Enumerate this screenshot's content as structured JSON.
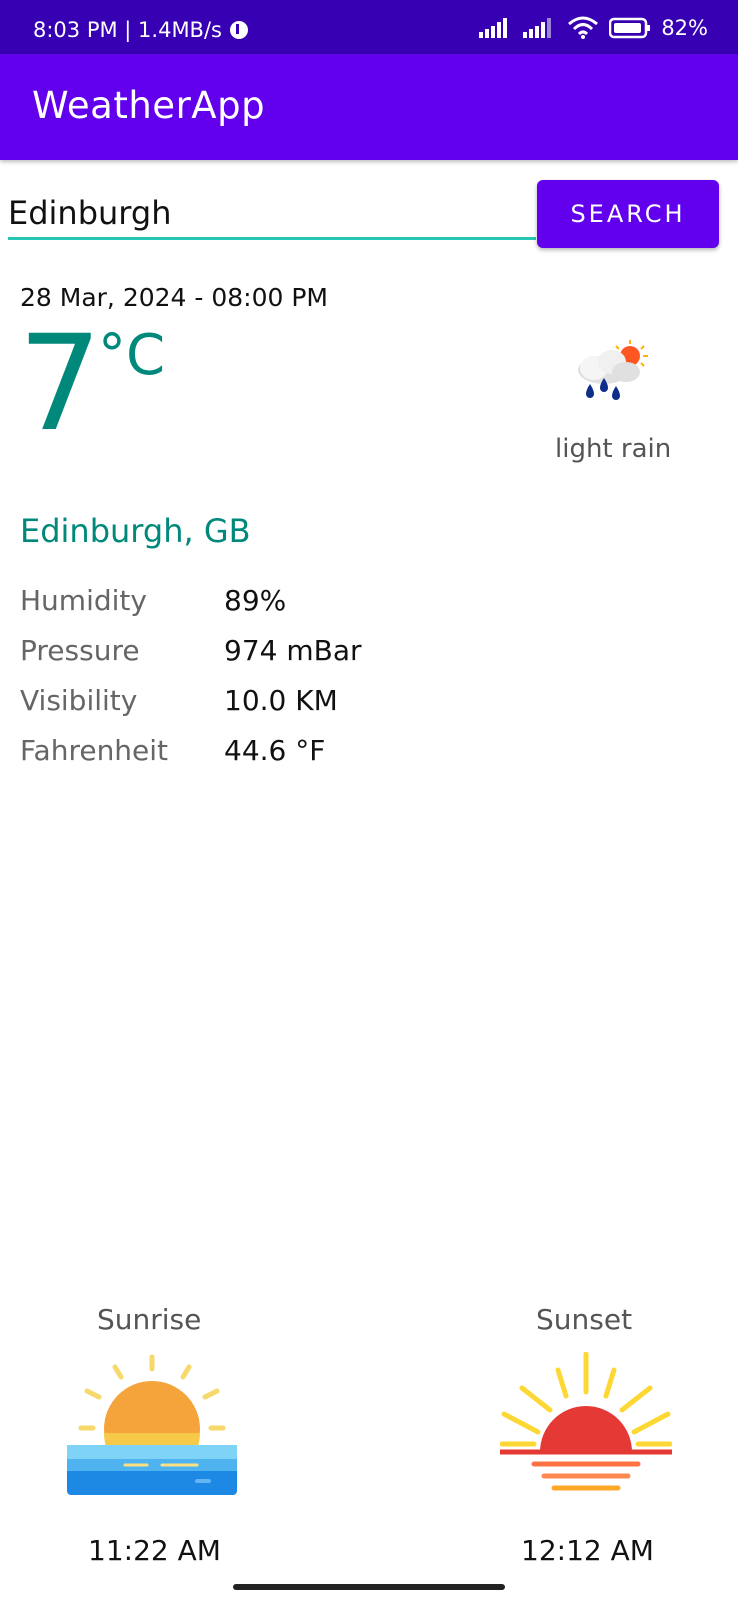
{
  "status_bar": {
    "time_speed": "8:03 PM | 1.4MB/s",
    "battery": "82%"
  },
  "app": {
    "title": "WeatherApp"
  },
  "search": {
    "value": "Edinburgh",
    "button_label": "SEARCH"
  },
  "weather": {
    "datetime": "28 Mar, 2024 - 08:00 PM",
    "temperature": "7",
    "unit": "°C",
    "condition": "light rain",
    "icon": "rain-cloud-sun-icon",
    "location": "Edinburgh, GB",
    "details": [
      {
        "label": "Humidity",
        "value": "89%"
      },
      {
        "label": "Pressure",
        "value": "974 mBar"
      },
      {
        "label": "Visibility",
        "value": "10.0 KM"
      },
      {
        "label": "Fahrenheit",
        "value": "44.6 °F"
      }
    ]
  },
  "sun": {
    "sunrise_label": "Sunrise",
    "sunrise_time": "11:22 AM",
    "sunset_label": "Sunset",
    "sunset_time": "12:12 AM"
  },
  "colors": {
    "primary": "#6200EE",
    "primary_dark": "#3700B3",
    "teal": "#00897B",
    "accent_line": "#26C6B5"
  }
}
